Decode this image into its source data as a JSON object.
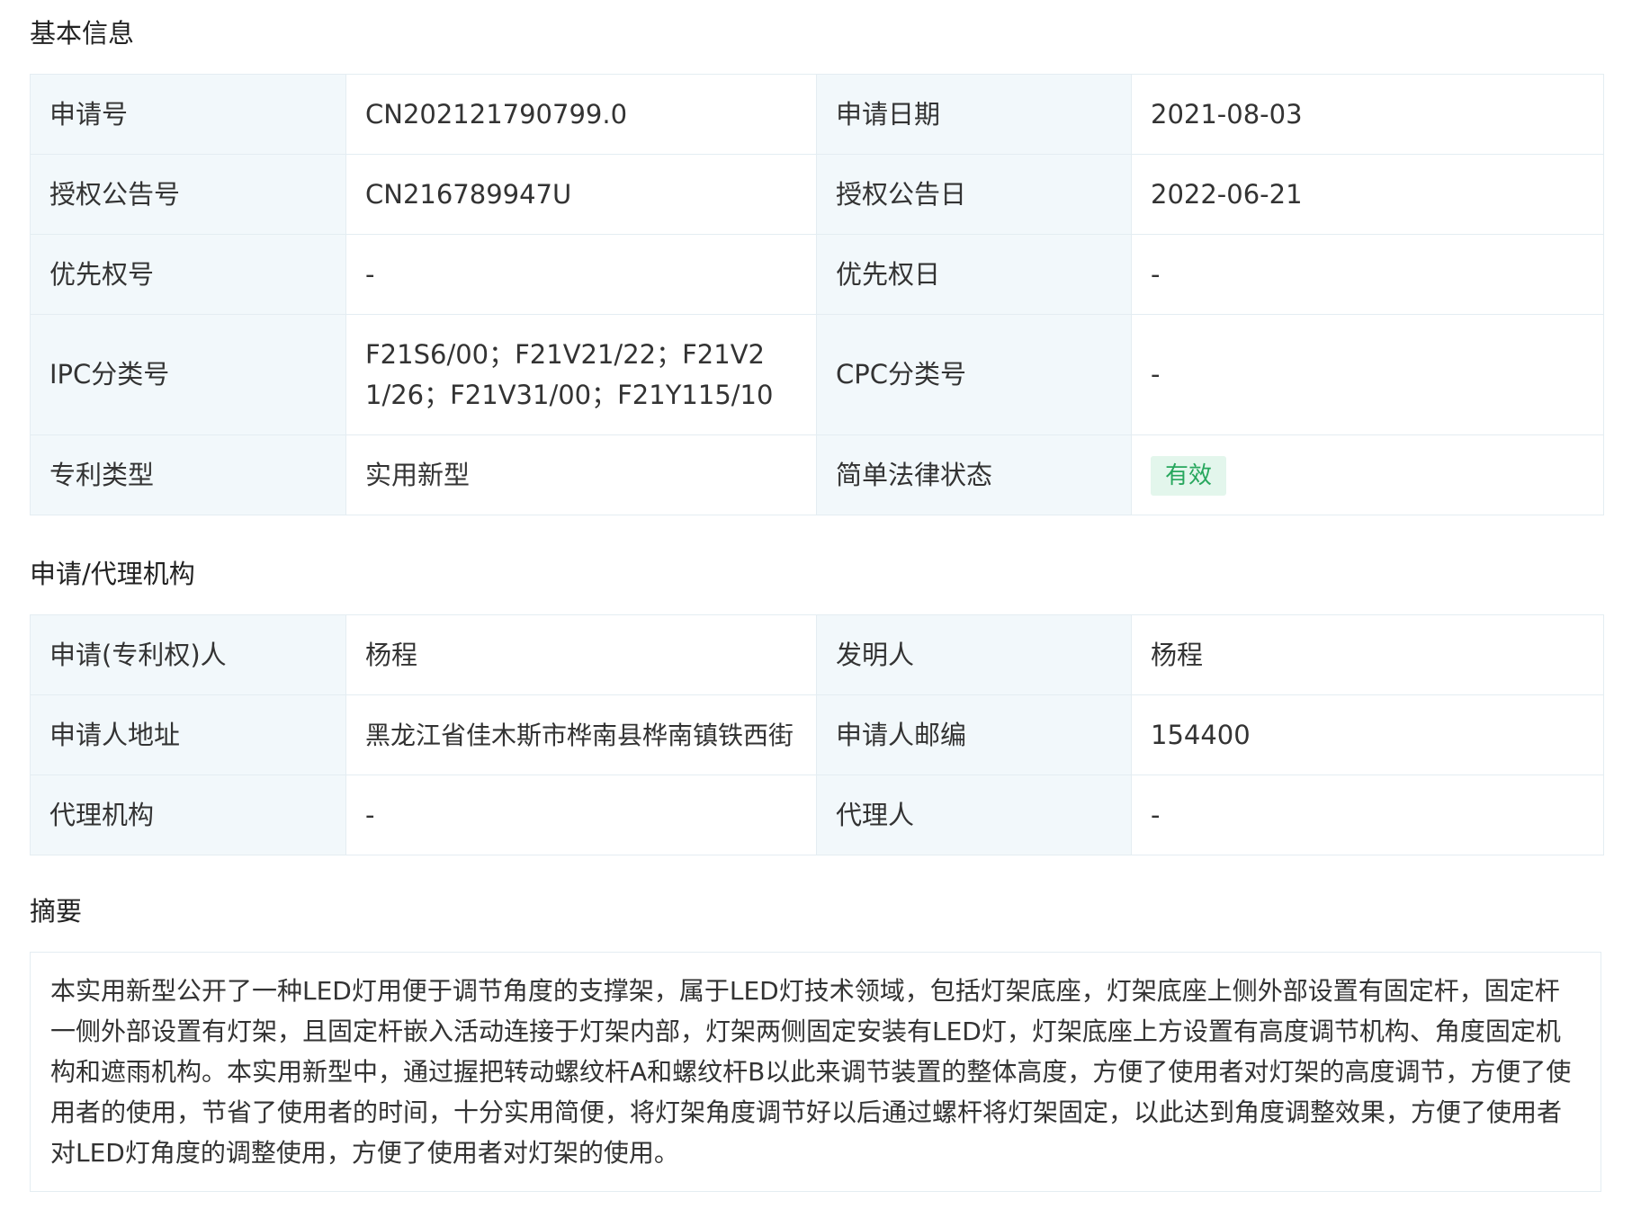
{
  "sections": {
    "basic_info_title": "基本信息",
    "applicant_title": "申请/代理机构",
    "abstract_title": "摘要"
  },
  "basic_info": {
    "app_no_label": "申请号",
    "app_no_value": "CN202121790799.0",
    "app_date_label": "申请日期",
    "app_date_value": "2021-08-03",
    "grant_no_label": "授权公告号",
    "grant_no_value": "CN216789947U",
    "grant_date_label": "授权公告日",
    "grant_date_value": "2022-06-21",
    "priority_no_label": "优先权号",
    "priority_no_value": "-",
    "priority_date_label": "优先权日",
    "priority_date_value": "-",
    "ipc_label": "IPC分类号",
    "ipc_value": "F21S6/00；F21V21/22；F21V21/26；F21V31/00；F21Y115/10",
    "cpc_label": "CPC分类号",
    "cpc_value": "-",
    "patent_type_label": "专利类型",
    "patent_type_value": "实用新型",
    "legal_status_label": "简单法律状态",
    "legal_status_value": "有效",
    "legal_status_color": "#27a75d"
  },
  "applicant_info": {
    "applicant_label": "申请(专利权)人",
    "applicant_value": "杨程",
    "inventor_label": "发明人",
    "inventor_value": "杨程",
    "address_label": "申请人地址",
    "address_value": "黑龙江省佳木斯市桦南县桦南镇铁西街",
    "postcode_label": "申请人邮编",
    "postcode_value": "154400",
    "agency_label": "代理机构",
    "agency_value": "-",
    "agent_label": "代理人",
    "agent_value": "-"
  },
  "abstract": {
    "text": "本实用新型公开了一种LED灯用便于调节角度的支撑架，属于LED灯技术领域，包括灯架底座，灯架底座上侧外部设置有固定杆，固定杆一侧外部设置有灯架，且固定杆嵌入活动连接于灯架内部，灯架两侧固定安装有LED灯，灯架底座上方设置有高度调节机构、角度固定机构和遮雨机构。本实用新型中，通过握把转动螺纹杆A和螺纹杆B以此来调节装置的整体高度，方便了使用者对灯架的高度调节，方便了使用者的使用，节省了使用者的时间，十分实用简便，将灯架角度调节好以后通过螺杆将灯架固定，以此达到角度调整效果，方便了使用者对LED灯角度的调整使用，方便了使用者对灯架的使用。"
  }
}
